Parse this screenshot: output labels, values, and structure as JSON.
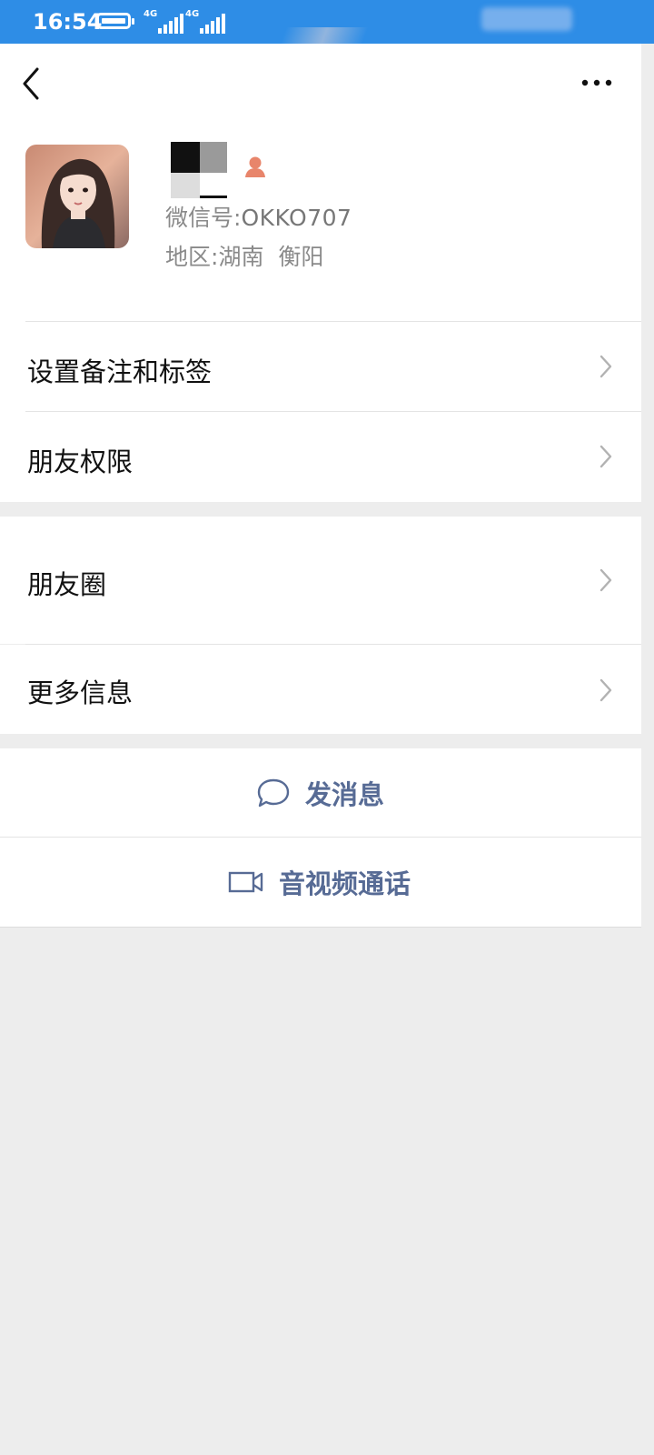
{
  "status_bar": {
    "time": "16:54",
    "network_1": "4G",
    "network_2": "4G"
  },
  "profile": {
    "name_visible": "",
    "wechat_id_label": "微信号:",
    "wechat_id": "OKKO707",
    "region_label": "地区:",
    "region_value": "湖南  衡阳"
  },
  "menu": [
    {
      "label": "设置备注和标签"
    },
    {
      "label": "朋友权限"
    },
    {
      "label": "朋友圈"
    },
    {
      "label": "更多信息"
    }
  ],
  "actions": {
    "message": "发消息",
    "call": "音视频通话"
  },
  "colors": {
    "status_bar": "#2e8de6",
    "link_blue": "#576b95",
    "background": "#ededed",
    "gender_icon": "#e8856b"
  },
  "icons": [
    "back-icon",
    "more-icon",
    "gender-icon",
    "chat-bubble-icon",
    "video-camera-icon",
    "chevron-right-icon"
  ]
}
